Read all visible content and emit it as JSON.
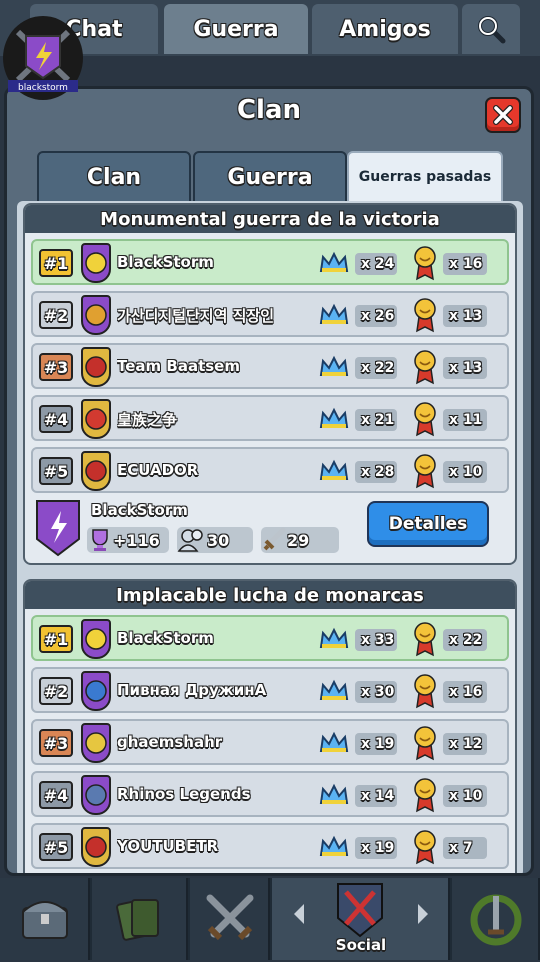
{
  "top_tabs": [
    {
      "label": "Chat"
    },
    {
      "label": "Guerra"
    },
    {
      "label": "Amigos"
    }
  ],
  "modal": {
    "title": "Clan",
    "tabs": [
      {
        "label": "Clan"
      },
      {
        "label": "Guerra"
      },
      {
        "label": "Guerras pasadas"
      }
    ]
  },
  "wars": [
    {
      "title": "Monumental guerra de la victoria",
      "rows": [
        {
          "rank": "#1",
          "name": "BlackStorm",
          "crowns": "x 24",
          "medals": "x 16"
        },
        {
          "rank": "#2",
          "name": "가산디지털단지역 직장인",
          "crowns": "x 26",
          "medals": "x 13"
        },
        {
          "rank": "#3",
          "name": "Team Baatsem",
          "crowns": "x 22",
          "medals": "x 13"
        },
        {
          "rank": "#4",
          "name": "皇族之争",
          "crowns": "x 21",
          "medals": "x 11"
        },
        {
          "rank": "#5",
          "name": "ECUADOR",
          "crowns": "x 28",
          "medals": "x 10"
        }
      ],
      "summary": {
        "clan_name": "BlackStorm",
        "trophies": "+116",
        "members": "30",
        "battles": "29",
        "details_label": "Detalles"
      }
    },
    {
      "title": "Implacable lucha de monarcas",
      "rows": [
        {
          "rank": "#1",
          "name": "BlackStorm",
          "crowns": "x 33",
          "medals": "x 22"
        },
        {
          "rank": "#2",
          "name": "Пивная ДружинА",
          "crowns": "x 30",
          "medals": "x 16"
        },
        {
          "rank": "#3",
          "name": "ghaemshahr",
          "crowns": "x 19",
          "medals": "x 12"
        },
        {
          "rank": "#4",
          "name": "Rhinos Legends",
          "crowns": "x 14",
          "medals": "x 10"
        },
        {
          "rank": "#5",
          "name": "YOUTUBETR",
          "crowns": "x 19",
          "medals": "x 7"
        }
      ]
    }
  ],
  "bottom_nav": {
    "active_label": "Social"
  },
  "colors": {
    "rank1": "#f2c232",
    "rank2": "#c7ced6",
    "rank3": "#d98655",
    "rank_other": "#8d99a6",
    "details_button": "#2f8ee8",
    "close_button": "#e5382b"
  }
}
